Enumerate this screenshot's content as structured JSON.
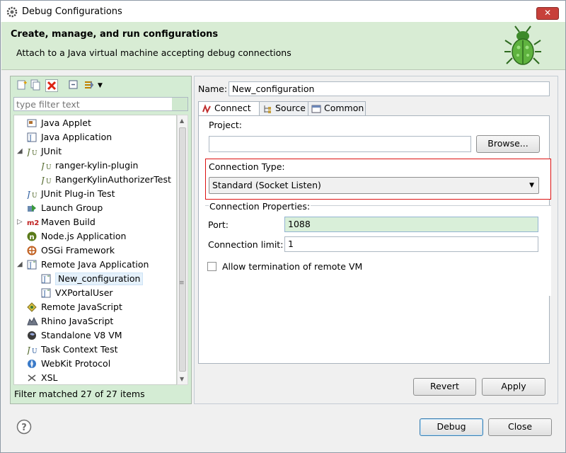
{
  "window": {
    "title": "Debug Configurations",
    "close_glyph": "✕"
  },
  "banner": {
    "heading": "Create, manage, and run configurations",
    "message": "Attach to a Java virtual machine accepting debug connections"
  },
  "left": {
    "filter_placeholder": "type filter text",
    "status": "Filter matched 27 of 27 items",
    "tree": [
      {
        "label": "Java Applet",
        "indent": 0,
        "icon": "java-applet-icon"
      },
      {
        "label": "Java Application",
        "indent": 0,
        "icon": "java-application-icon"
      },
      {
        "label": "JUnit",
        "indent": 0,
        "icon": "junit-icon",
        "expanded": true
      },
      {
        "label": "ranger-kylin-plugin",
        "indent": 1,
        "icon": "junit-icon"
      },
      {
        "label": "RangerKylinAuthorizerTest",
        "indent": 1,
        "icon": "junit-icon"
      },
      {
        "label": "JUnit Plug-in Test",
        "indent": 0,
        "icon": "junit-plugin-icon"
      },
      {
        "label": "Launch Group",
        "indent": 0,
        "icon": "launch-group-icon"
      },
      {
        "label": "Maven Build",
        "indent": 0,
        "icon": "maven-icon",
        "collapsed": true
      },
      {
        "label": "Node.js Application",
        "indent": 0,
        "icon": "nodejs-icon"
      },
      {
        "label": "OSGi Framework",
        "indent": 0,
        "icon": "osgi-icon"
      },
      {
        "label": "Remote Java Application",
        "indent": 0,
        "icon": "remote-java-icon",
        "expanded": true
      },
      {
        "label": "New_configuration",
        "indent": 1,
        "icon": "remote-java-icon",
        "selected": true
      },
      {
        "label": "VXPortalUser",
        "indent": 1,
        "icon": "remote-java-icon"
      },
      {
        "label": "Remote JavaScript",
        "indent": 0,
        "icon": "remote-javascript-icon"
      },
      {
        "label": "Rhino JavaScript",
        "indent": 0,
        "icon": "rhino-icon"
      },
      {
        "label": "Standalone V8 VM",
        "indent": 0,
        "icon": "v8-icon"
      },
      {
        "label": "Task Context Test",
        "indent": 0,
        "icon": "task-context-icon"
      },
      {
        "label": "WebKit Protocol",
        "indent": 0,
        "icon": "webkit-icon"
      },
      {
        "label": "XSL",
        "indent": 0,
        "icon": "xsl-icon"
      }
    ]
  },
  "right": {
    "name_label": "Name:",
    "name_value": "New_configuration",
    "tabs": [
      {
        "label": "Connect",
        "active": true
      },
      {
        "label": "Source",
        "active": false
      },
      {
        "label": "Common",
        "active": false
      }
    ],
    "project_label": "Project:",
    "project_value": "",
    "browse_label": "Browse...",
    "connection_type_label": "Connection Type:",
    "connection_type_value": "Standard (Socket Listen)",
    "connection_properties_label": "Connection Properties:",
    "port_label": "Port:",
    "port_value": "1088",
    "limit_label": "Connection limit:",
    "limit_value": "1",
    "allow_termination_label": "Allow termination of remote VM",
    "revert_label": "Revert",
    "apply_label": "Apply"
  },
  "footer": {
    "debug_label": "Debug",
    "close_label": "Close",
    "help_glyph": "?"
  },
  "colors": {
    "banner_bg": "#d8ecd4",
    "left_pane_bg": "#d4ecd4",
    "highlight_border": "#dd1111",
    "port_bg": "#d9efd9"
  }
}
